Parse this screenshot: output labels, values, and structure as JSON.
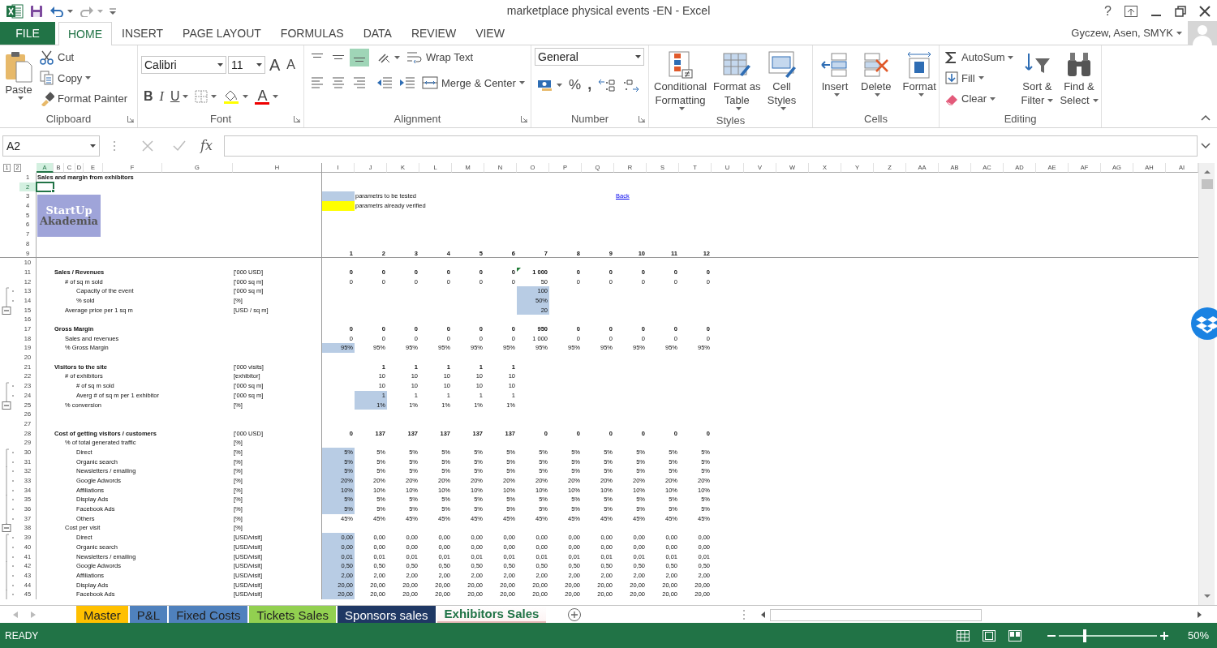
{
  "title_bar": {
    "title": "marketplace physical events -EN - Excel",
    "help": "?"
  },
  "ribbon_tabs": [
    {
      "label": "FILE",
      "kind": "file",
      "selected": false
    },
    {
      "label": "HOME",
      "kind": "tab",
      "selected": true
    },
    {
      "label": "INSERT",
      "kind": "tab",
      "selected": false
    },
    {
      "label": "PAGE LAYOUT",
      "kind": "tab",
      "selected": false
    },
    {
      "label": "FORMULAS",
      "kind": "tab",
      "selected": false
    },
    {
      "label": "DATA",
      "kind": "tab",
      "selected": false
    },
    {
      "label": "REVIEW",
      "kind": "tab",
      "selected": false
    },
    {
      "label": "VIEW",
      "kind": "tab",
      "selected": false
    }
  ],
  "user": "Gyczew, Asen, SMYK",
  "ribbon": {
    "clipboard": {
      "label": "Clipboard",
      "launcher": true,
      "paste": "Paste",
      "cut": "Cut",
      "copy": "Copy",
      "format_painter": "Format Painter"
    },
    "font": {
      "label": "Font",
      "launcher": true,
      "family": "Calibri",
      "size": "11",
      "grow": "A",
      "shrink": "A",
      "bold": "B",
      "italic": "I",
      "underline": "U",
      "font_color": "A"
    },
    "alignment": {
      "label": "Alignment",
      "launcher": true,
      "vertical_align": [
        {
          "selected": false
        },
        {
          "selected": false
        },
        {
          "selected": true
        }
      ],
      "wrap_text": "Wrap Text",
      "merge": "Merge & Center"
    },
    "number": {
      "label": "Number",
      "launcher": true,
      "format": "General",
      "percent": "%",
      "comma": ","
    },
    "styles": {
      "label": "Styles",
      "launcher": false,
      "buttons": [
        [
          "Conditional",
          "Formatting"
        ],
        [
          "Format as",
          "Table"
        ],
        [
          "Cell",
          "Styles"
        ]
      ]
    },
    "cells": {
      "label": "Cells",
      "launcher": false,
      "buttons": [
        "Insert",
        "Delete",
        "Format"
      ]
    },
    "editing": {
      "label": "Editing",
      "launcher": false,
      "autosum": "AutoSum",
      "fill": "Fill",
      "clear": "Clear",
      "sort_filter": [
        "Sort &",
        "Filter"
      ],
      "find_select": [
        "Find &",
        "Select"
      ]
    }
  },
  "formula_bar": {
    "name_box": "A2",
    "function_label": "fx"
  },
  "sheet": {
    "outline_levels": [
      "1",
      "2"
    ],
    "columns": [
      {
        "label": "A",
        "selected": true
      },
      {
        "label": "B",
        "selected": false
      },
      {
        "label": "C",
        "selected": false
      },
      {
        "label": "D",
        "selected": false
      },
      {
        "label": "E",
        "selected": false
      },
      {
        "label": "F",
        "selected": false
      },
      {
        "label": "G",
        "selected": false
      },
      {
        "label": "H",
        "selected": false
      },
      {
        "label": "I",
        "selected": false
      },
      {
        "label": "J",
        "selected": false
      },
      {
        "label": "K",
        "selected": false
      },
      {
        "label": "L",
        "selected": false
      },
      {
        "label": "M",
        "selected": false
      },
      {
        "label": "N",
        "selected": false
      },
      {
        "label": "O",
        "selected": false
      },
      {
        "label": "P",
        "selected": false
      },
      {
        "label": "Q",
        "selected": false
      },
      {
        "label": "R",
        "selected": false
      },
      {
        "label": "S",
        "selected": false
      },
      {
        "label": "T",
        "selected": false
      },
      {
        "label": "U",
        "selected": false
      },
      {
        "label": "V",
        "selected": false
      },
      {
        "label": "W",
        "selected": false
      },
      {
        "label": "X",
        "selected": false
      },
      {
        "label": "Y",
        "selected": false
      },
      {
        "label": "Z",
        "selected": false
      },
      {
        "label": "AA",
        "selected": false
      },
      {
        "label": "AB",
        "selected": false
      },
      {
        "label": "AC",
        "selected": false
      },
      {
        "label": "AD",
        "selected": false
      },
      {
        "label": "AE",
        "selected": false
      },
      {
        "label": "AF",
        "selected": false
      },
      {
        "label": "AG",
        "selected": false
      },
      {
        "label": "AH",
        "selected": false
      },
      {
        "label": "AI",
        "selected": false
      }
    ],
    "logo": {
      "lines": [
        "StartUp",
        "Akademia"
      ]
    },
    "legend": [
      {
        "label": "parametrs to be tested",
        "color": "#b8cce4"
      },
      {
        "label": "parametrs already verified",
        "color": "#ffff00"
      }
    ],
    "back_link": "Back",
    "rows": [
      {
        "n": "1",
        "selected": false,
        "kind": "title",
        "label": "Sales and margin from exhibitors",
        "bold": true
      },
      {
        "n": "2",
        "selected": true
      },
      {
        "n": "3",
        "selected": false
      },
      {
        "n": "4",
        "selected": false
      },
      {
        "n": "5",
        "selected": false
      },
      {
        "n": "6",
        "selected": false
      },
      {
        "n": "7",
        "selected": false
      },
      {
        "n": "8",
        "selected": false
      },
      {
        "n": "9",
        "selected": false,
        "bold": true,
        "values": [
          "1",
          "2",
          "3",
          "4",
          "5",
          "6",
          "7",
          "8",
          "9",
          "10",
          "11",
          "12"
        ]
      },
      {
        "n": "10",
        "selected": false
      },
      {
        "n": "11",
        "selected": false,
        "kind": "section",
        "label": "Sales / Revenues",
        "unit": "['000 USD]",
        "bold": true,
        "values": [
          "0",
          "0",
          "0",
          "0",
          "0",
          "0",
          {
            "text": "1 000",
            "flagged": true
          },
          "0",
          "0",
          "0",
          "0",
          "0"
        ]
      },
      {
        "n": "12",
        "selected": false,
        "kind": "item",
        "label": "# of sq m sold",
        "unit": "['000 sq m]",
        "values": [
          "0",
          "0",
          "0",
          "0",
          "0",
          "0",
          "50",
          "0",
          "0",
          "0",
          "0",
          "0"
        ]
      },
      {
        "n": "13",
        "selected": false,
        "outline": {
          "kind": "dot"
        },
        "kind": "subitem",
        "label": "Capacity of the event",
        "unit": "['000 sq m]",
        "values": [
          {
            "kind": "blank"
          },
          {
            "kind": "blank"
          },
          {
            "kind": "blank"
          },
          {
            "kind": "blank"
          },
          {
            "kind": "blank"
          },
          {
            "kind": "blank"
          },
          {
            "text": "100",
            "tested": true
          }
        ]
      },
      {
        "n": "14",
        "selected": false,
        "outline": {
          "kind": "dot"
        },
        "kind": "subitem",
        "label": "% sold",
        "unit": "[%]",
        "values": [
          {
            "kind": "blank"
          },
          {
            "kind": "blank"
          },
          {
            "kind": "blank"
          },
          {
            "kind": "blank"
          },
          {
            "kind": "blank"
          },
          {
            "kind": "blank"
          },
          {
            "text": "50%",
            "tested": true
          }
        ]
      },
      {
        "n": "15",
        "selected": false,
        "outline": {
          "kind": "collapse"
        },
        "kind": "item",
        "label": "Average price per 1 sq m",
        "unit": "[USD / sq m]",
        "values": [
          {
            "kind": "blank"
          },
          {
            "kind": "blank"
          },
          {
            "kind": "blank"
          },
          {
            "kind": "blank"
          },
          {
            "kind": "blank"
          },
          {
            "kind": "blank"
          },
          {
            "text": "20",
            "tested": true
          }
        ]
      },
      {
        "n": "16",
        "selected": false
      },
      {
        "n": "17",
        "selected": false,
        "kind": "section",
        "label": "Gross Margin",
        "bold": true,
        "values": [
          "0",
          "0",
          "0",
          "0",
          "0",
          "0",
          "950",
          "0",
          "0",
          "0",
          "0",
          "0"
        ]
      },
      {
        "n": "18",
        "selected": false,
        "kind": "item",
        "label": "Sales and revenues",
        "values": [
          "0",
          "0",
          "0",
          "0",
          "0",
          "0",
          "1 000",
          "0",
          "0",
          "0",
          "0",
          "0"
        ]
      },
      {
        "n": "19",
        "selected": false,
        "kind": "item",
        "label": "% Gross Margin",
        "values": [
          {
            "text": "95%",
            "tested": true
          },
          "95%",
          "95%",
          "95%",
          "95%",
          "95%",
          "95%",
          "95%",
          "95%",
          "95%",
          "95%",
          "95%"
        ]
      },
      {
        "n": "20",
        "selected": false
      },
      {
        "n": "21",
        "selected": false,
        "kind": "section",
        "label": "Visitors to the site",
        "unit": "['000 visits]",
        "bold": true,
        "values": [
          {
            "kind": "blank"
          },
          "1",
          "1",
          "1",
          "1",
          "1"
        ]
      },
      {
        "n": "22",
        "selected": false,
        "kind": "item",
        "label": "# of exhibitors",
        "unit": "[exhibitor]",
        "values": [
          {
            "kind": "blank"
          },
          "10",
          "10",
          "10",
          "10",
          "10"
        ]
      },
      {
        "n": "23",
        "selected": false,
        "outline": {
          "kind": "dot"
        },
        "kind": "subitem",
        "label": "# of sq m sold",
        "unit": "['000 sq m]",
        "values": [
          {
            "kind": "blank"
          },
          "10",
          "10",
          "10",
          "10",
          "10"
        ]
      },
      {
        "n": "24",
        "selected": false,
        "outline": {
          "kind": "dot"
        },
        "kind": "subitem",
        "label": "Averg # of sq m per 1 exhibitor",
        "unit": "['000 sq m]",
        "values": [
          {
            "kind": "blank"
          },
          {
            "text": "1",
            "tested": true
          },
          "1",
          "1",
          "1",
          "1"
        ]
      },
      {
        "n": "25",
        "selected": false,
        "outline": {
          "kind": "collapse"
        },
        "kind": "item",
        "label": "% conversion",
        "unit": "[%]",
        "values": [
          {
            "kind": "blank"
          },
          {
            "text": "1%",
            "tested": true
          },
          "1%",
          "1%",
          "1%",
          "1%"
        ]
      },
      {
        "n": "26",
        "selected": false
      },
      {
        "n": "27",
        "selected": false
      },
      {
        "n": "28",
        "selected": false,
        "kind": "section",
        "label": "Cost of getting visitors / customers",
        "unit": "['000 USD]",
        "bold": true,
        "values": [
          "0",
          "137",
          "137",
          "137",
          "137",
          "137",
          "0",
          "0",
          "0",
          "0",
          "0",
          "0"
        ]
      },
      {
        "n": "29",
        "selected": false,
        "kind": "item",
        "label": "% of total generated traffic",
        "unit": "[%]"
      },
      {
        "n": "30",
        "selected": false,
        "outline": {
          "kind": "dot"
        },
        "kind": "subitem",
        "label": "Direct",
        "unit": "[%]",
        "values": [
          {
            "text": "5%",
            "tested": true
          },
          "5%",
          "5%",
          "5%",
          "5%",
          "5%",
          "5%",
          "5%",
          "5%",
          "5%",
          "5%",
          "5%"
        ]
      },
      {
        "n": "31",
        "selected": false,
        "outline": {
          "kind": "dot"
        },
        "kind": "subitem",
        "label": "Organic search",
        "unit": "[%]",
        "values": [
          {
            "text": "5%",
            "tested": true
          },
          "5%",
          "5%",
          "5%",
          "5%",
          "5%",
          "5%",
          "5%",
          "5%",
          "5%",
          "5%",
          "5%"
        ]
      },
      {
        "n": "32",
        "selected": false,
        "outline": {
          "kind": "dot"
        },
        "kind": "subitem",
        "label": "Newsletters / emailing",
        "unit": "[%]",
        "values": [
          {
            "text": "5%",
            "tested": true
          },
          "5%",
          "5%",
          "5%",
          "5%",
          "5%",
          "5%",
          "5%",
          "5%",
          "5%",
          "5%",
          "5%"
        ]
      },
      {
        "n": "33",
        "selected": false,
        "outline": {
          "kind": "dot"
        },
        "kind": "subitem",
        "label": "Google Adwords",
        "unit": "[%]",
        "values": [
          {
            "text": "20%",
            "tested": true
          },
          "20%",
          "20%",
          "20%",
          "20%",
          "20%",
          "20%",
          "20%",
          "20%",
          "20%",
          "20%",
          "20%"
        ]
      },
      {
        "n": "34",
        "selected": false,
        "outline": {
          "kind": "dot"
        },
        "kind": "subitem",
        "label": "Affiliations",
        "unit": "[%]",
        "values": [
          {
            "text": "10%",
            "tested": true
          },
          "10%",
          "10%",
          "10%",
          "10%",
          "10%",
          "10%",
          "10%",
          "10%",
          "10%",
          "10%",
          "10%"
        ]
      },
      {
        "n": "35",
        "selected": false,
        "outline": {
          "kind": "dot"
        },
        "kind": "subitem",
        "label": "Display Ads",
        "unit": "[%]",
        "values": [
          {
            "text": "5%",
            "tested": true
          },
          "5%",
          "5%",
          "5%",
          "5%",
          "5%",
          "5%",
          "5%",
          "5%",
          "5%",
          "5%",
          "5%"
        ]
      },
      {
        "n": "36",
        "selected": false,
        "outline": {
          "kind": "dot"
        },
        "kind": "subitem",
        "label": "Facebook Ads",
        "unit": "[%]",
        "values": [
          {
            "text": "5%",
            "tested": true
          },
          "5%",
          "5%",
          "5%",
          "5%",
          "5%",
          "5%",
          "5%",
          "5%",
          "5%",
          "5%",
          "5%"
        ]
      },
      {
        "n": "37",
        "selected": false,
        "outline": {
          "kind": "dot"
        },
        "kind": "subitem",
        "label": "Others",
        "unit": "[%]",
        "values": [
          "45%",
          "45%",
          "45%",
          "45%",
          "45%",
          "45%",
          "45%",
          "45%",
          "45%",
          "45%",
          "45%",
          "45%"
        ]
      },
      {
        "n": "38",
        "selected": false,
        "outline": {
          "kind": "collapse"
        },
        "kind": "item",
        "label": "Cost per visit",
        "unit": "[%]"
      },
      {
        "n": "39",
        "selected": false,
        "outline": {
          "kind": "dot"
        },
        "kind": "subitem",
        "label": "Direct",
        "unit": "[USD/visit]",
        "values": [
          {
            "text": "0,00",
            "tested": true
          },
          "0,00",
          "0,00",
          "0,00",
          "0,00",
          "0,00",
          "0,00",
          "0,00",
          "0,00",
          "0,00",
          "0,00",
          "0,00"
        ]
      },
      {
        "n": "40",
        "selected": false,
        "outline": {
          "kind": "dot"
        },
        "kind": "subitem",
        "label": "Organic search",
        "unit": "[USD/visit]",
        "values": [
          {
            "text": "0,00",
            "tested": true
          },
          "0,00",
          "0,00",
          "0,00",
          "0,00",
          "0,00",
          "0,00",
          "0,00",
          "0,00",
          "0,00",
          "0,00",
          "0,00"
        ]
      },
      {
        "n": "41",
        "selected": false,
        "outline": {
          "kind": "dot"
        },
        "kind": "subitem",
        "label": "Newsletters / emailing",
        "unit": "[USD/visit]",
        "values": [
          {
            "text": "0,01",
            "tested": true
          },
          "0,01",
          "0,01",
          "0,01",
          "0,01",
          "0,01",
          "0,01",
          "0,01",
          "0,01",
          "0,01",
          "0,01",
          "0,01"
        ]
      },
      {
        "n": "42",
        "selected": false,
        "outline": {
          "kind": "dot"
        },
        "kind": "subitem",
        "label": "Google Adwords",
        "unit": "[USD/visit]",
        "values": [
          {
            "text": "0,50",
            "tested": true
          },
          "0,50",
          "0,50",
          "0,50",
          "0,50",
          "0,50",
          "0,50",
          "0,50",
          "0,50",
          "0,50",
          "0,50",
          "0,50"
        ]
      },
      {
        "n": "43",
        "selected": false,
        "outline": {
          "kind": "dot"
        },
        "kind": "subitem",
        "label": "Affiliations",
        "unit": "[USD/visit]",
        "values": [
          {
            "text": "2,00",
            "tested": true
          },
          "2,00",
          "2,00",
          "2,00",
          "2,00",
          "2,00",
          "2,00",
          "2,00",
          "2,00",
          "2,00",
          "2,00",
          "2,00"
        ]
      },
      {
        "n": "44",
        "selected": false,
        "outline": {
          "kind": "dot"
        },
        "kind": "subitem",
        "label": "Display Ads",
        "unit": "[USD/visit]",
        "values": [
          {
            "text": "20,00",
            "tested": true
          },
          "20,00",
          "20,00",
          "20,00",
          "20,00",
          "20,00",
          "20,00",
          "20,00",
          "20,00",
          "20,00",
          "20,00",
          "20,00"
        ]
      },
      {
        "n": "45",
        "selected": false,
        "outline": {
          "kind": "dot"
        },
        "kind": "subitem",
        "label": "Facebook Ads",
        "unit": "[USD/visit]",
        "values": [
          {
            "text": "20,00",
            "tested": true
          },
          "20,00",
          "20,00",
          "20,00",
          "20,00",
          "20,00",
          "20,00",
          "20,00",
          "20,00",
          "20,00",
          "20,00",
          "20,00"
        ]
      }
    ]
  },
  "sheet_tabs": [
    {
      "label": "Master",
      "color": "#ffc000",
      "selected": false
    },
    {
      "label": "P&L",
      "color": "#4f81bd",
      "selected": false
    },
    {
      "label": "Fixed Costs",
      "color": "#4f81bd",
      "selected": false
    },
    {
      "label": "Tickets Sales",
      "color": "#92d050",
      "selected": false
    },
    {
      "label": "Sponsors sales",
      "color": "#1f3864",
      "selected": false
    },
    {
      "label": "Exhibitors Sales",
      "color": "#e6b8b7",
      "selected": true
    }
  ],
  "status_bar": {
    "status": "READY",
    "zoom": "50%",
    "zoom_slider": {
      "level": 0.25
    }
  }
}
